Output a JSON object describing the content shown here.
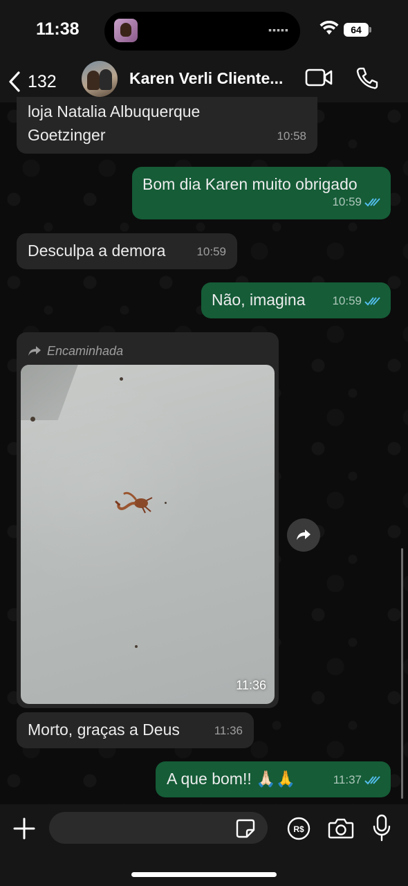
{
  "status_bar": {
    "time": "11:38",
    "battery": "64"
  },
  "header": {
    "back_count": "132",
    "chat_title": "Karen Verli Cliente..."
  },
  "messages": [
    {
      "direction": "incoming",
      "lines": [
        "loja Natalia Albuquerque",
        "Goetzinger"
      ],
      "time": "10:58"
    },
    {
      "direction": "outgoing",
      "text": "Bom dia Karen muito obrigado",
      "time": "10:59",
      "read": true
    },
    {
      "direction": "incoming",
      "text": "Desculpa a demora",
      "time": "10:59"
    },
    {
      "direction": "outgoing",
      "text": "Não, imagina",
      "time": "10:59",
      "read": true
    },
    {
      "direction": "incoming",
      "type": "image",
      "forwarded_label": "Encaminhada",
      "time": "11:36"
    },
    {
      "direction": "incoming",
      "text": "Morto, graças a Deus",
      "time": "11:36"
    },
    {
      "direction": "outgoing",
      "text": "A que bom!! 🙏🏻🙏",
      "time": "11:37",
      "read": true
    }
  ],
  "input": {
    "placeholder": ""
  },
  "icons": {
    "back": "chevron-left-icon",
    "video": "video-call-icon",
    "phone": "phone-icon",
    "forward": "forward-arrow-icon",
    "share": "share-icon",
    "plus": "plus-icon",
    "sticker": "sticker-icon",
    "payment": "pay-icon",
    "camera": "camera-icon",
    "mic": "microphone-icon"
  },
  "colors": {
    "outgoing_bubble": "#155c37",
    "incoming_bubble": "#262626",
    "read_ticks": "#53bdeb"
  }
}
